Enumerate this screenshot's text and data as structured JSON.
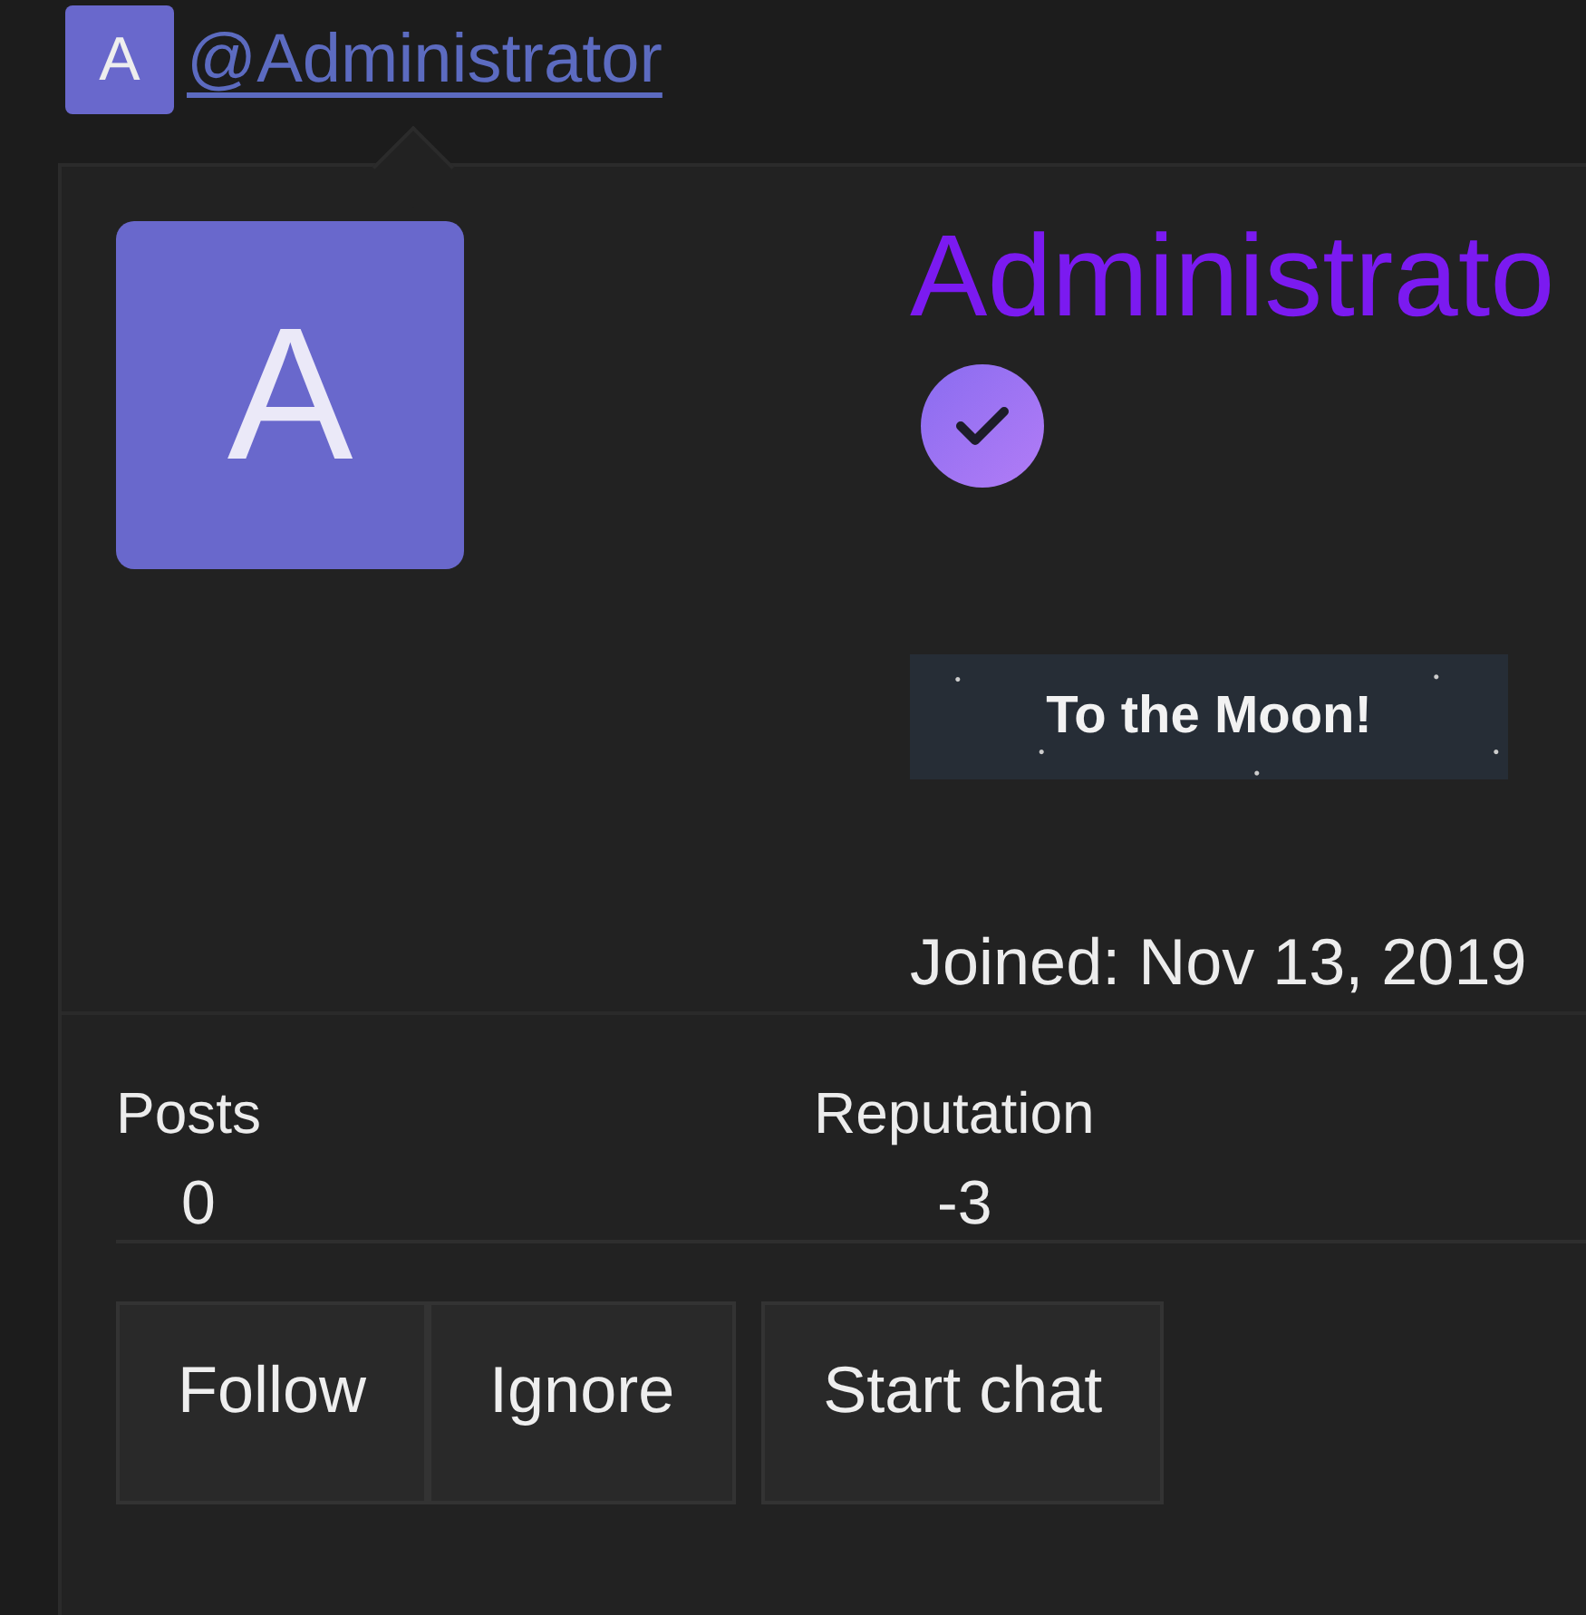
{
  "mention": {
    "avatar_letter": "A",
    "text": "@Administrator"
  },
  "profile_card": {
    "avatar_letter": "A",
    "name": "Administrato",
    "verified": true,
    "banner": "To the Moon!",
    "joined": "Joined: Nov 13, 2019",
    "stats": [
      {
        "label": "Posts",
        "value": "0"
      },
      {
        "label": "Reputation",
        "value": "-3"
      }
    ],
    "button_groups": [
      [
        "Follow",
        "Ignore"
      ],
      [
        "Start chat"
      ]
    ]
  }
}
